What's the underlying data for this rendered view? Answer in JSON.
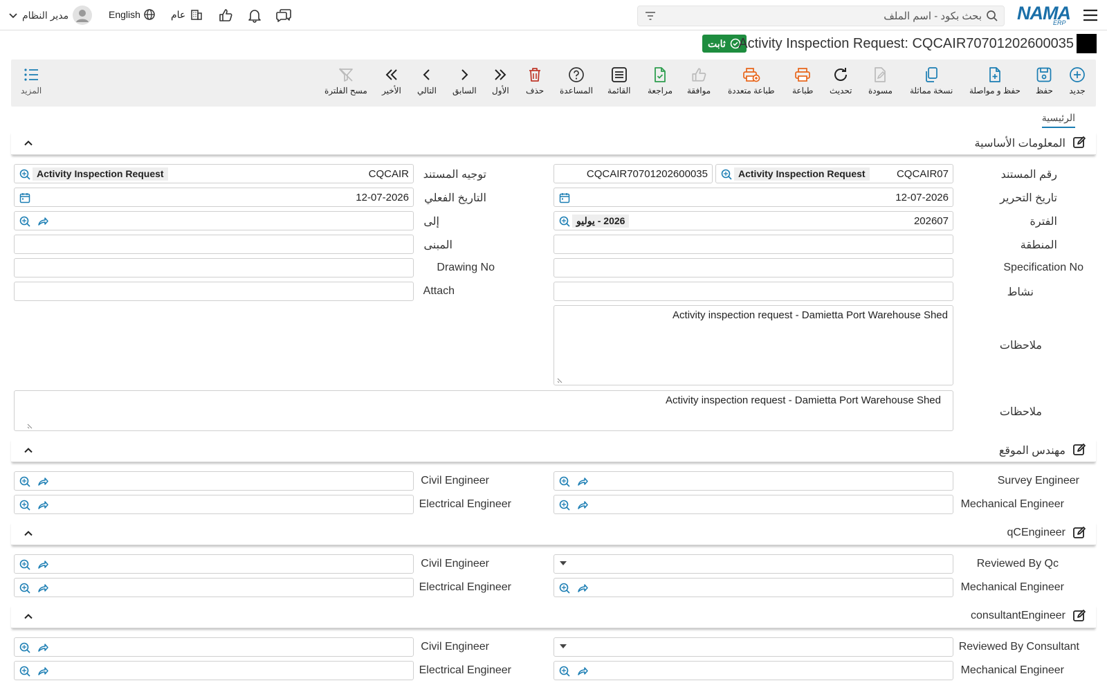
{
  "topbar": {
    "user": "مدير النظام",
    "language": "English",
    "branch": "عام",
    "search_placeholder": "بحث بكود - اسم الملف",
    "logo_text": "NAMA",
    "logo_sub": "ERP"
  },
  "document": {
    "title": "Activity Inspection Request: CQCAIR70701202600035",
    "status": "ثابت"
  },
  "toolbar": {
    "more": "المزيد",
    "clear_filter": "مسح الفلترة",
    "last": "الأخير",
    "next": "التالي",
    "prev": "السابق",
    "first": "الأول",
    "delete": "حذف",
    "help": "المساعدة",
    "list": "القائمة",
    "review": "مراجعة",
    "approve": "موافقة",
    "multi_print": "طباعة متعددة",
    "print": "طباعة",
    "refresh": "تحديث",
    "draft": "مسودة",
    "duplicate": "نسخة مماثلة",
    "save_continue": "حفظ و مواصلة",
    "save": "حفظ",
    "new": "جديد"
  },
  "tabs": {
    "main": "الرئيسية"
  },
  "sections": {
    "basic": "المعلومات الأساسية",
    "site": "مهندس الموقع",
    "qc": "qCEngineer",
    "consultant": "consultantEngineer"
  },
  "basic": {
    "doc_number_label": "رقم المستند",
    "doc_number_code": "CQCAIR07",
    "doc_number_type": "Activity Inspection Request",
    "doc_number_value": "CQCAIR70701202600035",
    "doc_direction_label": "توجيه المستند",
    "doc_direction_code": "CQCAIR",
    "doc_direction_type": "Activity Inspection Request",
    "edit_date_label": "تاريخ التحرير",
    "edit_date": "12-07-2026",
    "actual_date_label": "التاريخ الفعلي",
    "actual_date": "12-07-2026",
    "period_label": "الفترة",
    "period_code": "202607",
    "period_name": "2026 - يوليو",
    "to_label": "إلى",
    "region_label": "المنطقة",
    "building_label": "المبنى",
    "spec_label": "Specification No",
    "drawing_label": "Drawing No",
    "activity_label": "نشاط",
    "attach_label": "Attach",
    "notes_label": "ملاحظات",
    "notes_value": "Activity inspection request - Damietta Port Warehouse Shed",
    "notes2_label": "ملاحظات",
    "notes2_value": "Activity inspection request - Damietta Port Warehouse Shed"
  },
  "site": {
    "survey": "Survey Engineer",
    "civil": "Civil Engineer",
    "mechanical": "Mechanical Engineer",
    "electrical": "Electrical Engineer"
  },
  "qc": {
    "reviewed": "Reviewed By Qc",
    "civil": "Civil Engineer",
    "mechanical": "Mechanical Engineer",
    "electrical": "Electrical Engineer"
  },
  "consultant": {
    "reviewed": "Reviewed By Consultant",
    "civil": "Civil Engineer",
    "mechanical": "Mechanical Engineer",
    "electrical": "Electrical Engineer"
  },
  "colors": {
    "accent": "#1a7db3",
    "status": "#1e8d3f",
    "danger": "#c0392b",
    "orange": "#e8651a",
    "green": "#2e9e4f"
  }
}
